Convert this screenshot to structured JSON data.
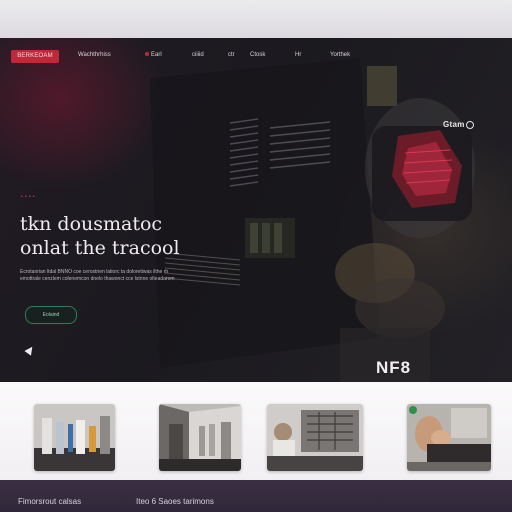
{
  "nav": {
    "button_label": "BERKEOAM",
    "links": [
      "Wachthrhiss",
      "Earl",
      "ciiiid",
      "ctr",
      "Ctosk",
      "Hr",
      "Yorthek"
    ]
  },
  "hero": {
    "badge": "Gtam",
    "eyebrow": "•  •  •  •",
    "headline_line1": "tkn dousmatoc",
    "headline_line2": "onlat  the  tracool",
    "body_line1": "Ecrotanrian ltdal BNNO coe cerostrien latiorc ta doloretiwas ilthe rh",
    "body_line2": "emottrale cenzlem colenemcon dnelo thawonct cce lstnne olteadarom",
    "cta_label": "Eolaind",
    "tag": "NF8",
    "accent_color": "#c0283a",
    "cta_color": "#2e7d57"
  },
  "gallery": {
    "cards": [
      "lab-instruments",
      "server-room",
      "engineer-workstation",
      "hands-at-keyboard"
    ]
  },
  "footer": {
    "left_text": "Fimorsrout calsas",
    "right_text": "Iteo 6 Saoes tarimons"
  }
}
